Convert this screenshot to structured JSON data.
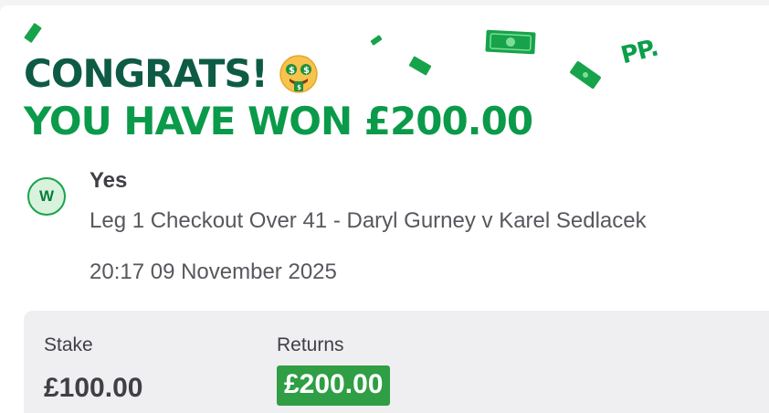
{
  "brand": {
    "logo_text": "PP."
  },
  "headline": {
    "congrats": "CONGRATS!",
    "won": "YOU HAVE WON £200.00",
    "emoji": "money-mouth-face-icon"
  },
  "bet": {
    "badge": "W",
    "selection": "Yes",
    "market": "Leg 1 Checkout Over 41 - Daryl Gurney v Karel Sedlacek",
    "datetime": "20:17 09 November 2025"
  },
  "summary": {
    "stake_label": "Stake",
    "stake_value": "£100.00",
    "returns_label": "Returns",
    "returns_value": "£200.00"
  },
  "colors": {
    "brand_green": "#0a9a4a",
    "dark_green": "#0e5b45",
    "returns_green": "#2f9e44"
  }
}
